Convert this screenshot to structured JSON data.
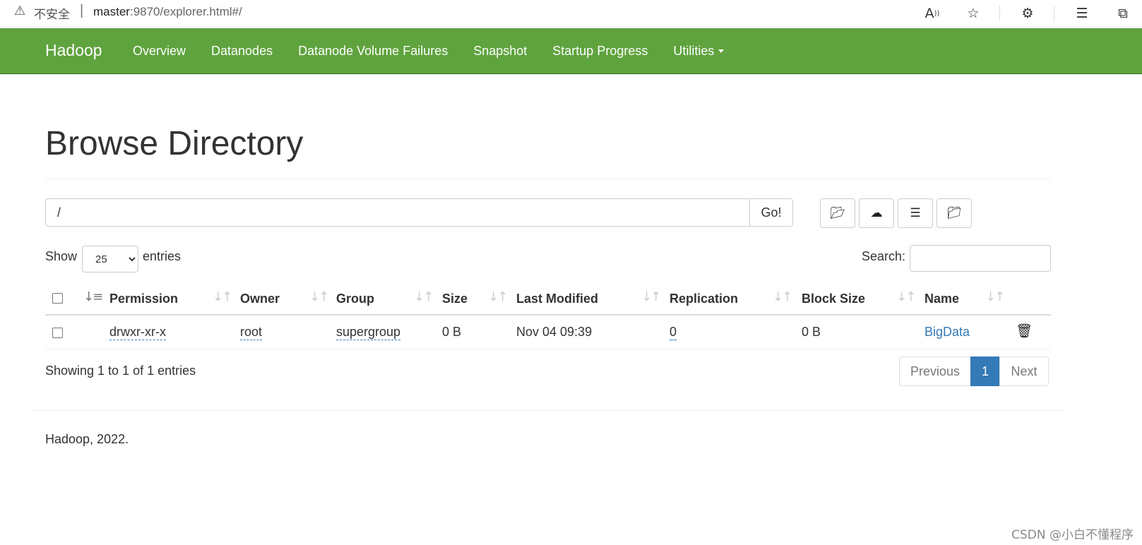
{
  "browser": {
    "warning_icon": "warning-icon",
    "insecure_label": "不安全",
    "separator": "|",
    "url_host": "master",
    "url_rest": ":9870/explorer.html#/",
    "icons": [
      "read-aloud-icon",
      "add-favorite-icon",
      "extensions-icon",
      "favorites-icon",
      "collections-icon"
    ]
  },
  "navbar": {
    "brand": "Hadoop",
    "items": [
      "Overview",
      "Datanodes",
      "Datanode Volume Failures",
      "Snapshot",
      "Startup Progress",
      "Utilities"
    ],
    "bg_color": "#5fa33e"
  },
  "page": {
    "title": "Browse Directory",
    "path_value": "/",
    "go_label": "Go!",
    "toolbar_icons": [
      "folder-open-icon",
      "cloud-upload-icon",
      "list-alt-icon",
      "folder-paste-icon"
    ]
  },
  "table_controls": {
    "show_label": "Show",
    "entries_value": "25",
    "entries_label": "entries",
    "search_label": "Search:"
  },
  "table": {
    "columns": [
      "Permission",
      "Owner",
      "Group",
      "Size",
      "Last Modified",
      "Replication",
      "Block Size",
      "Name"
    ],
    "rows": [
      {
        "permission": "drwxr-xr-x",
        "owner": "root",
        "group": "supergroup",
        "size": "0 B",
        "last_modified": "Nov 04 09:39",
        "replication": "0",
        "block_size": "0 B",
        "name": "BigData"
      }
    ]
  },
  "pagination": {
    "info": "Showing 1 to 1 of 1 entries",
    "previous": "Previous",
    "current": "1",
    "next": "Next",
    "active_color": "#337ab7"
  },
  "footer": {
    "text": "Hadoop, 2022."
  },
  "watermark": "CSDN @小白不懂程序"
}
